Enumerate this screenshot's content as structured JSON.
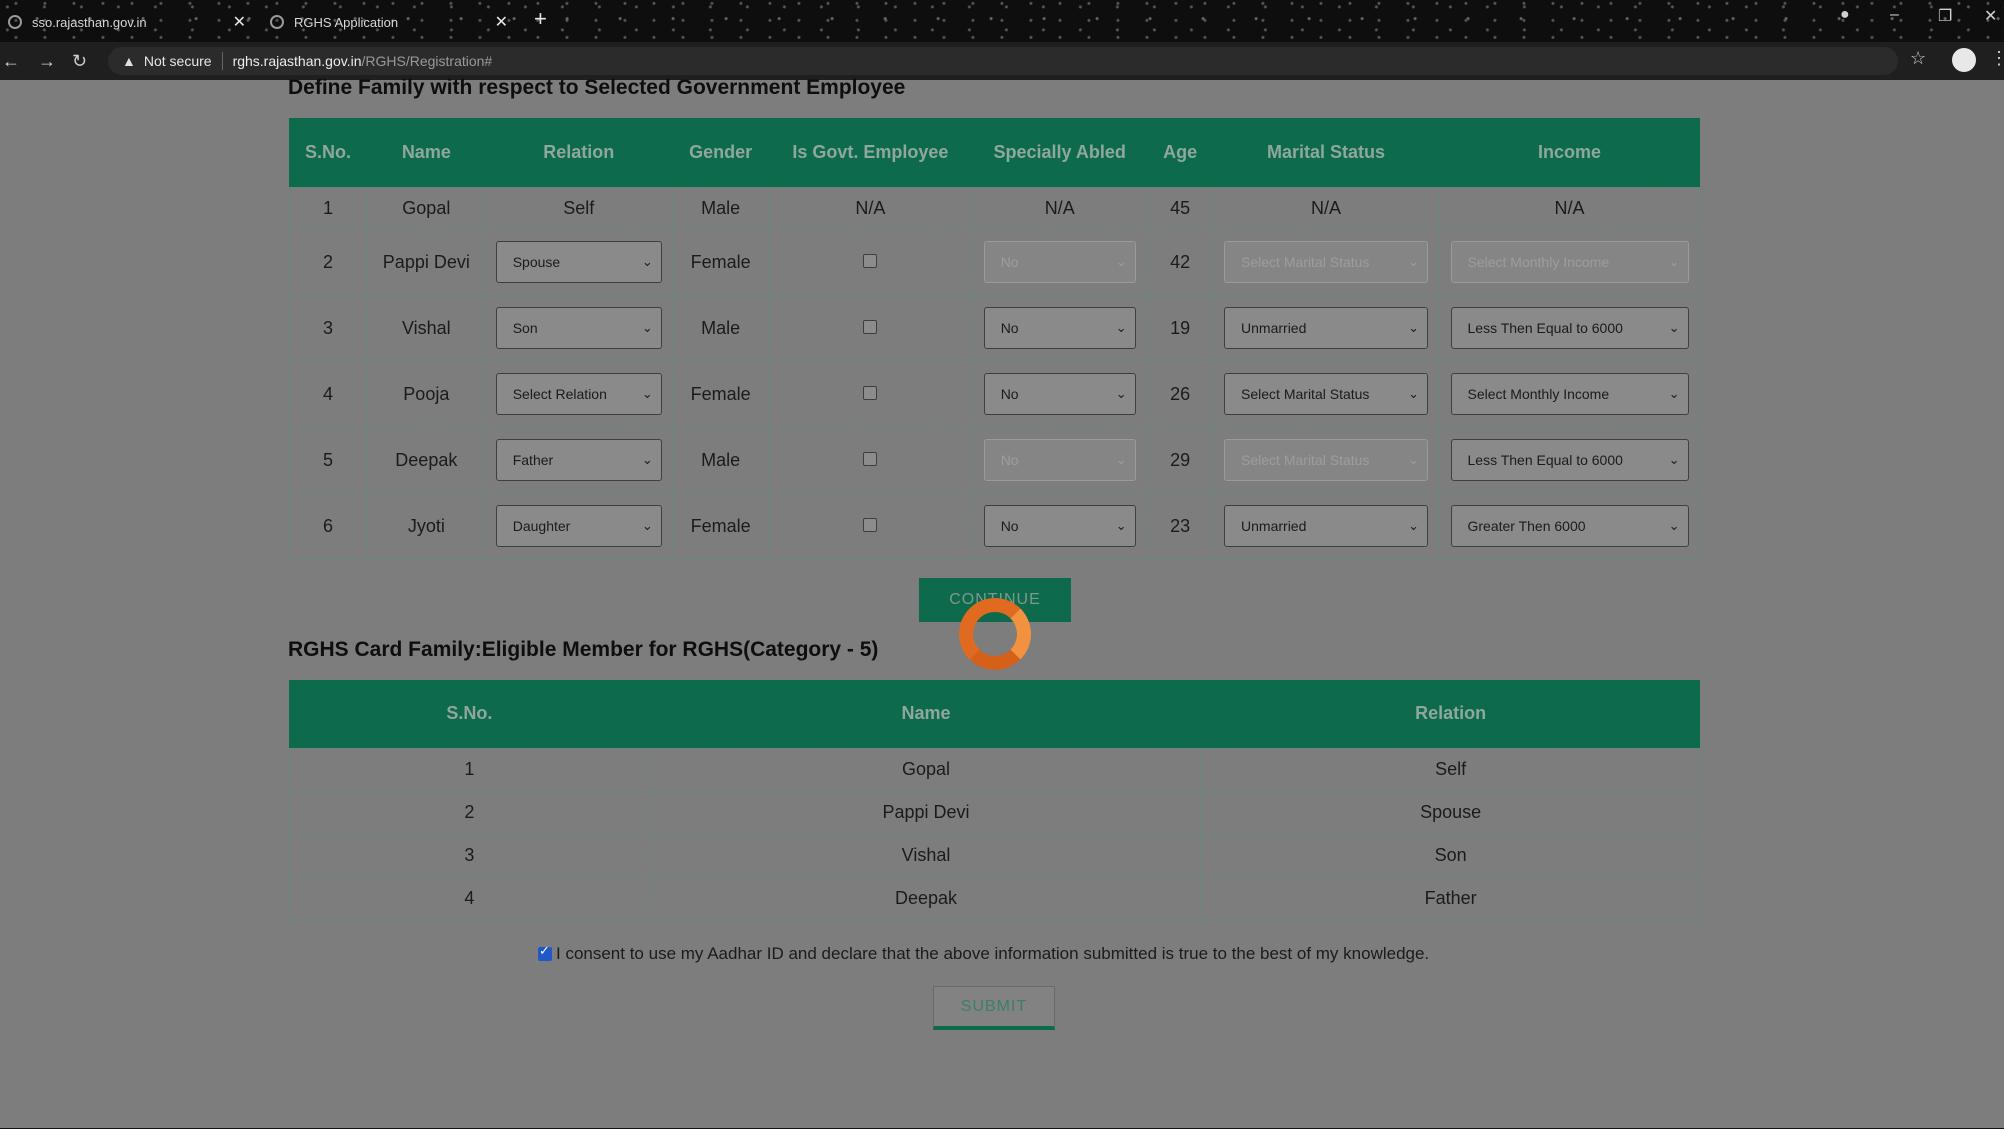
{
  "browser": {
    "tabs": [
      {
        "label": "sso.rajasthan.gov.in"
      },
      {
        "label": "RGHS Application"
      }
    ],
    "security_label": "Not secure",
    "url_host": "rghs.rajasthan.gov.in",
    "url_path": "/RGHS/Registration#"
  },
  "family_section": {
    "title": "Define Family with respect to Selected Government Employee",
    "headers": [
      "S.No.",
      "Name",
      "Relation",
      "Gender",
      "Is Govt. Employee",
      "Specially Abled",
      "Age",
      "Marital Status",
      "Income"
    ],
    "self_row": {
      "sno": "1",
      "name": "Gopal",
      "relation": "Self",
      "gender": "Male",
      "govt": "N/A",
      "abled": "N/A",
      "age": "45",
      "marital": "N/A",
      "income": "N/A"
    },
    "rows": [
      {
        "sno": "2",
        "name": "Pappi Devi",
        "relation": "Spouse",
        "gender": "Female",
        "abled": "No",
        "age": "42",
        "marital": "Select Marital Status",
        "income": "Select Monthly Income",
        "abled_disabled": true,
        "marital_disabled": true,
        "income_disabled": true
      },
      {
        "sno": "3",
        "name": "Vishal",
        "relation": "Son",
        "gender": "Male",
        "abled": "No",
        "age": "19",
        "marital": "Unmarried",
        "income": "Less Then Equal to 6000",
        "abled_disabled": false,
        "marital_disabled": false,
        "income_disabled": false
      },
      {
        "sno": "4",
        "name": "Pooja",
        "relation": "Select Relation",
        "gender": "Female",
        "abled": "No",
        "age": "26",
        "marital": "Select Marital Status",
        "income": "Select Monthly Income",
        "abled_disabled": false,
        "marital_disabled": false,
        "income_disabled": false
      },
      {
        "sno": "5",
        "name": "Deepak",
        "relation": "Father",
        "gender": "Male",
        "abled": "No",
        "age": "29",
        "marital": "Select Marital Status",
        "income": "Less Then Equal to 6000",
        "abled_disabled": true,
        "marital_disabled": true,
        "income_disabled": false
      },
      {
        "sno": "6",
        "name": "Jyoti",
        "relation": "Daughter",
        "gender": "Female",
        "abled": "No",
        "age": "23",
        "marital": "Unmarried",
        "income": "Greater Then 6000",
        "abled_disabled": false,
        "marital_disabled": false,
        "income_disabled": false
      }
    ],
    "continue_label": "CONTINUE"
  },
  "eligible_section": {
    "title": "RGHS Card Family:Eligible Member for RGHS(Category - 5)",
    "headers": [
      "S.No.",
      "Name",
      "Relation"
    ],
    "rows": [
      {
        "sno": "1",
        "name": "Gopal",
        "relation": "Self"
      },
      {
        "sno": "2",
        "name": "Pappi Devi",
        "relation": "Spouse"
      },
      {
        "sno": "3",
        "name": "Vishal",
        "relation": "Son"
      },
      {
        "sno": "4",
        "name": "Deepak",
        "relation": "Father"
      }
    ]
  },
  "consent": {
    "text": "I consent to use my Aadhar ID and declare that the above information submitted is true to the best of my knowledge.",
    "checked": true
  },
  "submit_label": "SUBMIT",
  "colors": {
    "header_green": "#0e6a4c",
    "spinner_orange": "#e06a20"
  }
}
